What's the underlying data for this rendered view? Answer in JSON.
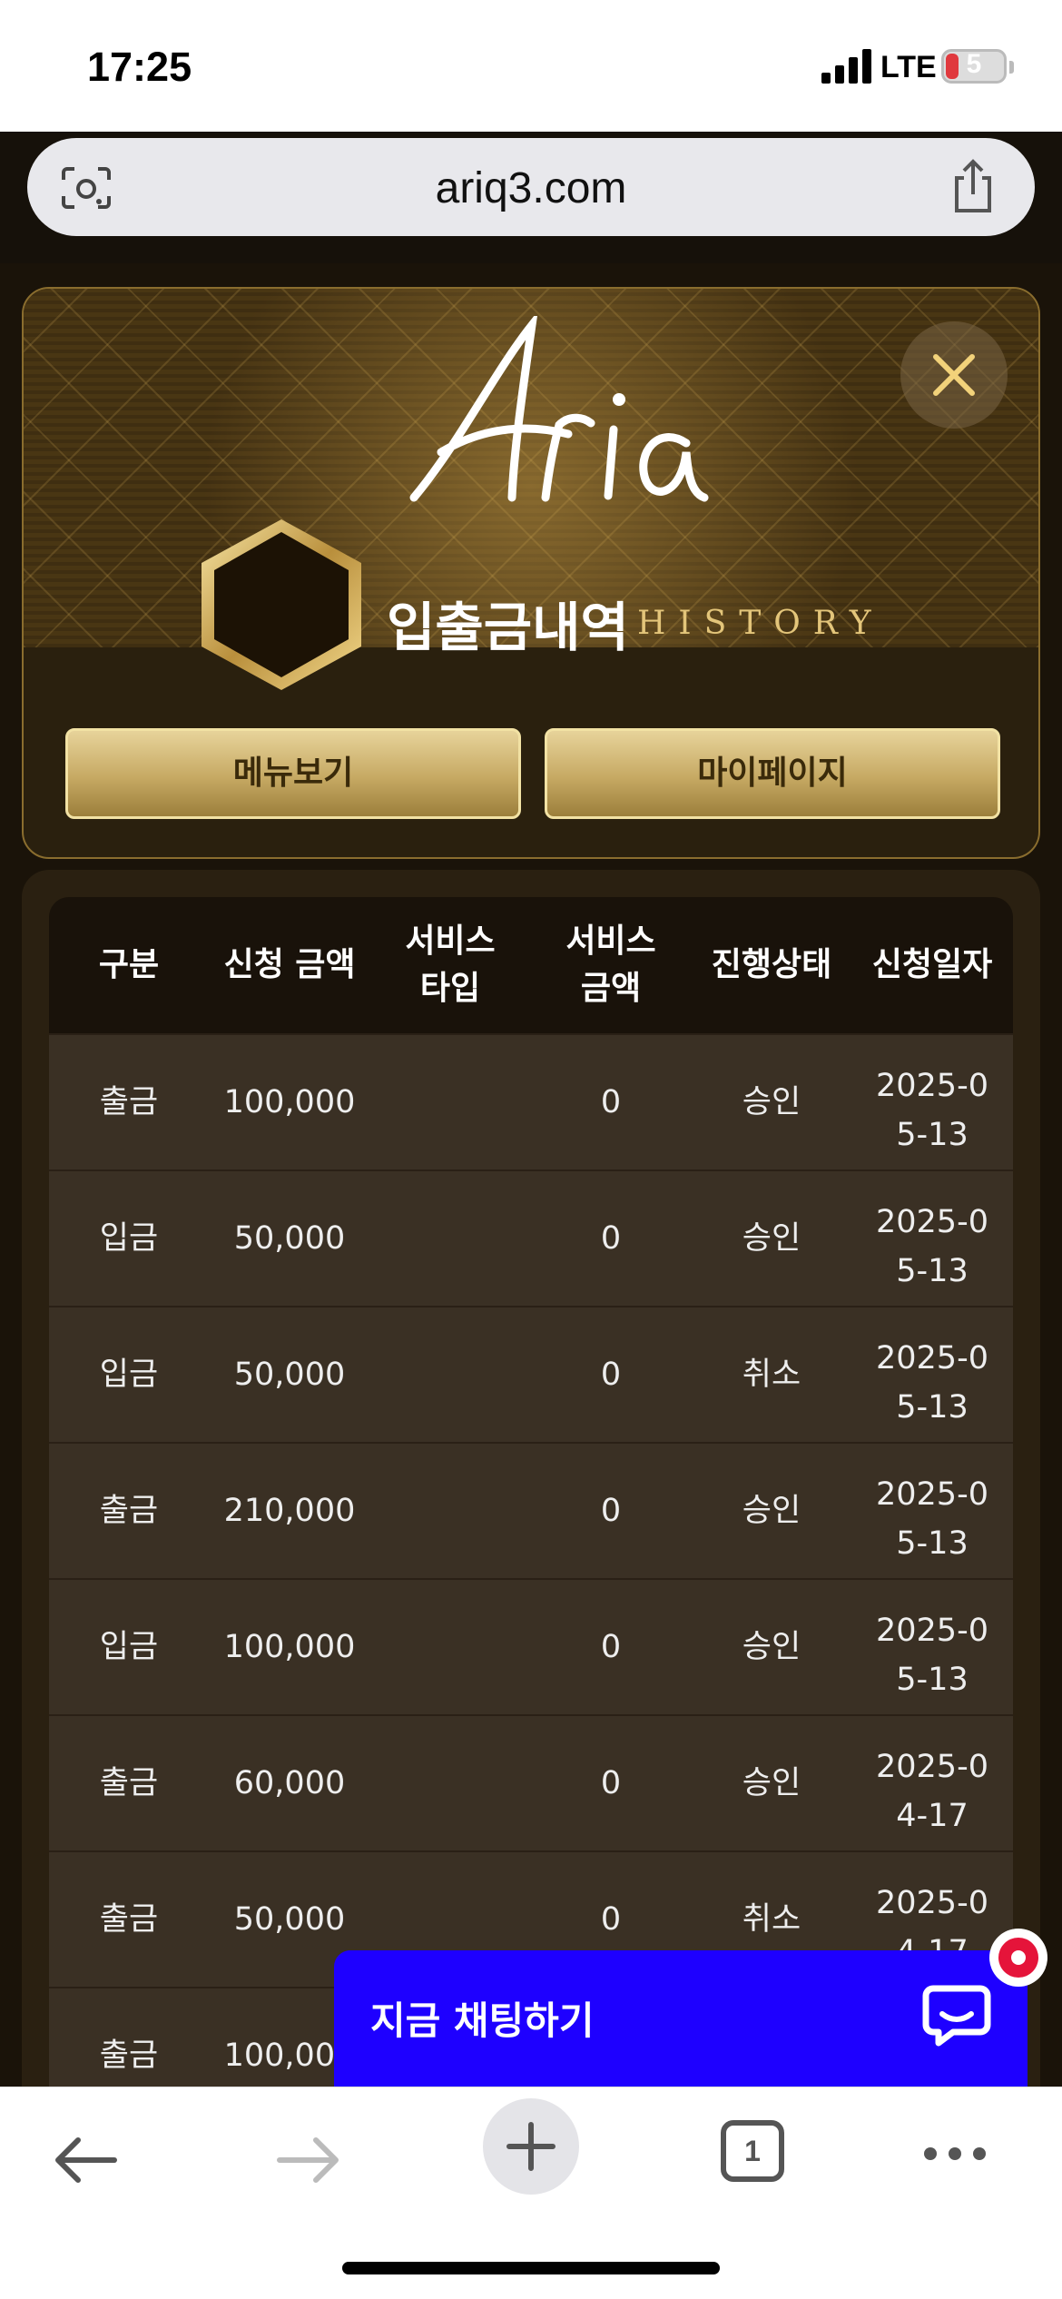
{
  "status_bar": {
    "time": "17:25",
    "network": "LTE",
    "battery": "5"
  },
  "browser": {
    "url": "ariq3.com"
  },
  "header": {
    "logo_text": "Aria",
    "title_kr": "입출금내역",
    "title_en": "HISTORY",
    "menu_button": "메뉴보기",
    "mypage_button": "마이페이지"
  },
  "table": {
    "columns": [
      "구분",
      "신청 금액",
      "서비스타입",
      "서비스금액",
      "진행상태",
      "신청일자"
    ],
    "rows": [
      {
        "type": "출금",
        "amount": "100,000",
        "service_type": "",
        "service_amount": "0",
        "status": "승인",
        "date": "2025-05-13"
      },
      {
        "type": "입금",
        "amount": "50,000",
        "service_type": "",
        "service_amount": "0",
        "status": "승인",
        "date": "2025-05-13"
      },
      {
        "type": "입금",
        "amount": "50,000",
        "service_type": "",
        "service_amount": "0",
        "status": "취소",
        "date": "2025-05-13"
      },
      {
        "type": "출금",
        "amount": "210,000",
        "service_type": "",
        "service_amount": "0",
        "status": "승인",
        "date": "2025-05-13"
      },
      {
        "type": "입금",
        "amount": "100,000",
        "service_type": "",
        "service_amount": "0",
        "status": "승인",
        "date": "2025-05-13"
      },
      {
        "type": "출금",
        "amount": "60,000",
        "service_type": "",
        "service_amount": "0",
        "status": "승인",
        "date": "2025-04-17"
      },
      {
        "type": "출금",
        "amount": "50,000",
        "service_type": "",
        "service_amount": "0",
        "status": "취소",
        "date": "2025-04-17"
      },
      {
        "type": "출금",
        "amount": "100,000",
        "service_type": "",
        "service_amount": "",
        "status": "",
        "date": ""
      }
    ]
  },
  "chat_widget": {
    "label": "지금 채팅하기"
  },
  "bottom_bar": {
    "tab_count": "1"
  },
  "colors": {
    "gold": "#c6a963",
    "chat_blue": "#1e00ff",
    "row_bg": "#3a3024"
  }
}
